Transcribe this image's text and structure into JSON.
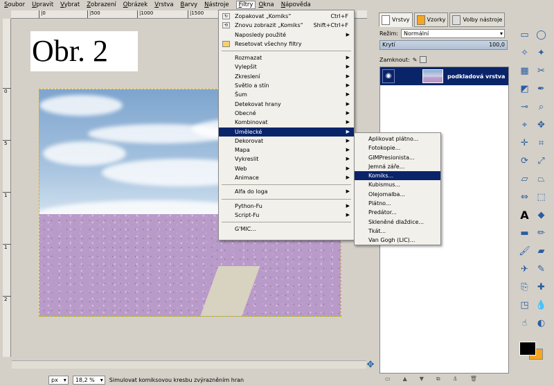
{
  "menubar": [
    {
      "label": "Soubor"
    },
    {
      "label": "Upravit"
    },
    {
      "label": "Vybrat"
    },
    {
      "label": "Zobrazení"
    },
    {
      "label": "Obrázek"
    },
    {
      "label": "Vrstva"
    },
    {
      "label": "Barvy"
    },
    {
      "label": "Nástroje"
    },
    {
      "label": "Filtry"
    },
    {
      "label": "Okna"
    },
    {
      "label": "Nápověda"
    }
  ],
  "ruler": {
    "top_ticks": [
      "|0",
      "|500",
      "|1000",
      "|1500"
    ],
    "left_ticks": [
      "0",
      "5",
      "1",
      "1",
      "2"
    ]
  },
  "image_label": "Obr. 2",
  "filters_menu": {
    "top_items": [
      {
        "label": "Zopakovat „Komiks“",
        "accel": "Ctrl+F",
        "icon": "repeat-icon"
      },
      {
        "label": "Znovu zobrazit „Komiks“",
        "accel": "Shift+Ctrl+F",
        "icon": "reshow-icon"
      },
      {
        "label": "Naposledy použité",
        "submenu": true
      },
      {
        "label": "Resetovat všechny filtry",
        "icon": "reset-icon"
      }
    ],
    "groups": [
      {
        "label": "Rozmazat"
      },
      {
        "label": "Vylepšit"
      },
      {
        "label": "Zkreslení"
      },
      {
        "label": "Světlo a stín"
      },
      {
        "label": "Šum"
      },
      {
        "label": "Detekovat hrany"
      },
      {
        "label": "Obecné"
      },
      {
        "label": "Kombinovat"
      },
      {
        "label": "Umělecké"
      },
      {
        "label": "Dekorovat"
      },
      {
        "label": "Mapa"
      },
      {
        "label": "Vykreslit"
      },
      {
        "label": "Web"
      },
      {
        "label": "Animace"
      }
    ],
    "alpha_item": "Alfa do loga",
    "script_items": [
      {
        "label": "Python-Fu"
      },
      {
        "label": "Script-Fu"
      }
    ],
    "gmic": "G'MIC..."
  },
  "artistic_menu": [
    {
      "label": "Aplikovat plátno..."
    },
    {
      "label": "Fotokopie..."
    },
    {
      "label": "GIMPresionista..."
    },
    {
      "label": "Jemná záře..."
    },
    {
      "label": "Komiks..."
    },
    {
      "label": "Kubismus..."
    },
    {
      "label": "Olejomalba..."
    },
    {
      "label": "Plátno..."
    },
    {
      "label": "Predátor..."
    },
    {
      "label": "Skleněné dlaždice..."
    },
    {
      "label": "Tkát..."
    },
    {
      "label": "Van Gogh (LIC)..."
    }
  ],
  "status": {
    "unit": "px",
    "zoom": "18,2 %",
    "message": "Simulovat komiksovou kresbu zvýrazněním hran"
  },
  "dock": {
    "tabs": [
      {
        "label": "Vrstvy"
      },
      {
        "label": "Vzorky"
      },
      {
        "label": "Volby nástroje"
      }
    ],
    "mode_label": "Režim:",
    "mode_value": "Normální",
    "opacity_label": "Krytí",
    "opacity_value": "100,0",
    "lock_label": "Zamknout:",
    "layer_name": "podkladová vrstva"
  },
  "colors": {
    "highlight": "#0a246a",
    "menu_bg": "#f2f0eb",
    "chrome": "#d4d0c8",
    "foreground": "#000000",
    "background_swatch": "#f5a623"
  }
}
